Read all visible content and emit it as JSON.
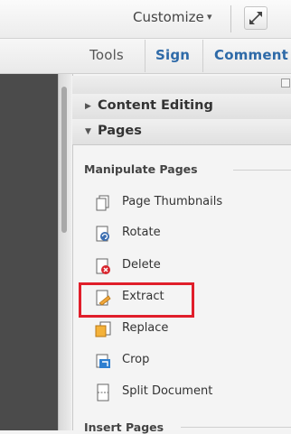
{
  "topbar": {
    "customize_label": "Customize",
    "customize_caret": "▾"
  },
  "tabs": [
    {
      "label": "Tools"
    },
    {
      "label": "Sign"
    },
    {
      "label": "Comment"
    }
  ],
  "panel": {
    "sections": [
      {
        "label": "Content Editing",
        "expanded": false
      },
      {
        "label": "Pages",
        "expanded": true
      }
    ],
    "group_title": "Manipulate Pages",
    "items": [
      {
        "label": "Page Thumbnails",
        "icon": "page-thumbnails-icon"
      },
      {
        "label": "Rotate",
        "icon": "rotate-icon"
      },
      {
        "label": "Delete",
        "icon": "delete-icon"
      },
      {
        "label": "Extract",
        "icon": "extract-icon"
      },
      {
        "label": "Replace",
        "icon": "replace-icon"
      },
      {
        "label": "Crop",
        "icon": "crop-icon"
      },
      {
        "label": "Split Document",
        "icon": "split-document-icon"
      }
    ],
    "next_group_title": "Insert Pages"
  },
  "colors": {
    "accent": "#2e6aa8",
    "highlight": "#e01e2a",
    "sidebar_dark": "#4b4b4b"
  }
}
